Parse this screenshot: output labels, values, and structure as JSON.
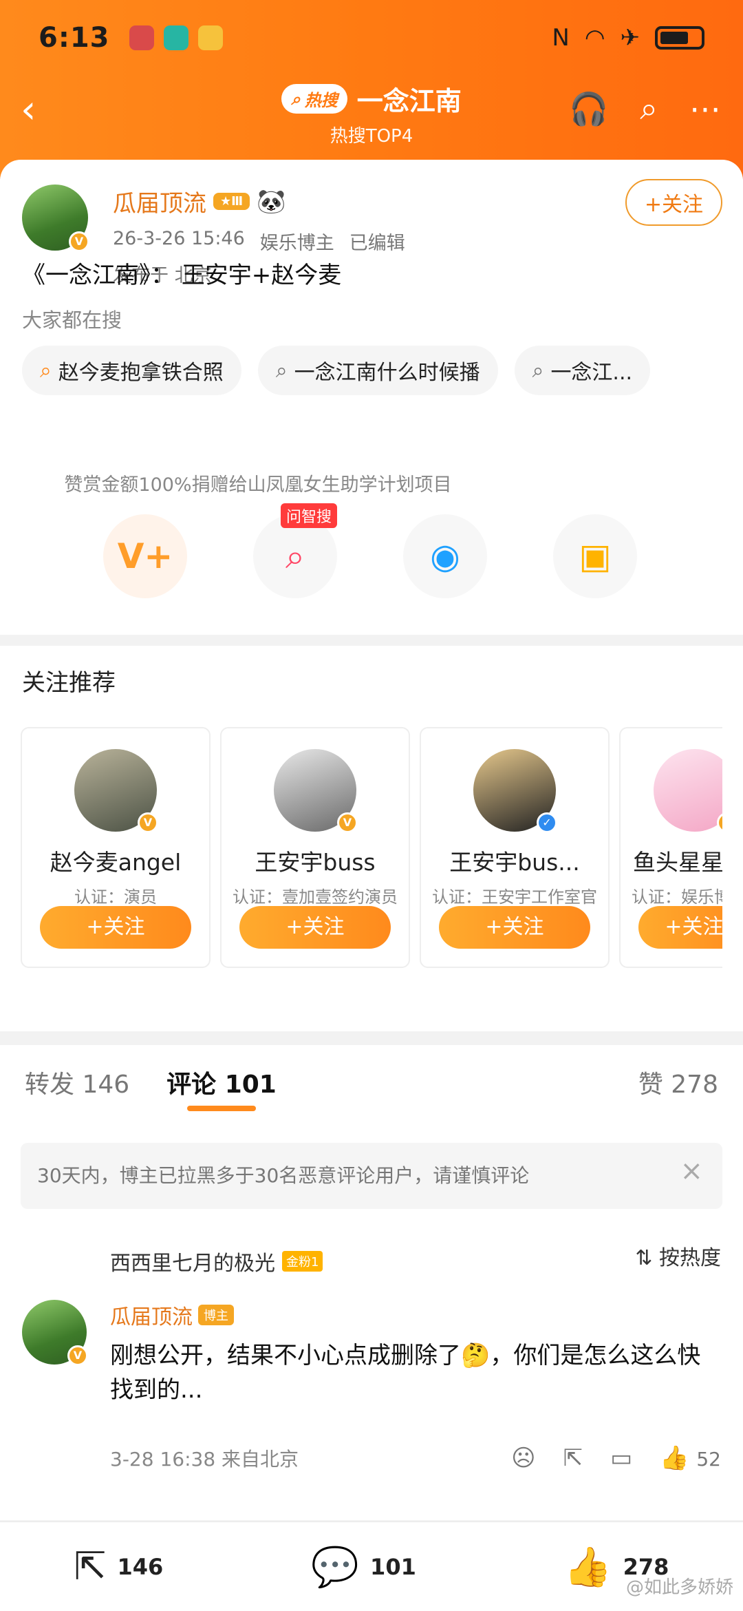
{
  "status": {
    "time": "6:13"
  },
  "nav": {
    "badge": "热搜",
    "title": "一念江南",
    "subtitle": "热搜TOP4"
  },
  "post": {
    "author": "瓜届顶流",
    "meta_date": "26-3-26 15:46",
    "meta_tag": "娱乐博主",
    "meta_edited": "已编辑",
    "location": "发布于 北京",
    "follow": "+关注",
    "text": "《一念江南》： 王安宇+赵今麦",
    "search_label": "大家都在搜",
    "chips": [
      "赵今麦抱拿铁合照",
      "一念江南什么时候播",
      "一念江..."
    ],
    "donate_text": "赞赏金额100%捐赠给山凤凰女生助学计划项目",
    "ai_tag": "问智搜"
  },
  "recommend": {
    "title": "关注推荐",
    "cards": [
      {
        "name": "赵今麦angel",
        "desc": "认证：演员",
        "follow": "+关注"
      },
      {
        "name": "王安宇buss",
        "desc": "认证：壹加壹签约演员",
        "follow": "+关注"
      },
      {
        "name": "王安宇bus...",
        "desc": "认证：王安宇工作室官方微博",
        "follow": "+关注"
      },
      {
        "name": "鱼头星星",
        "desc": "认证：娱乐博话主持人（一",
        "follow": "+关注"
      }
    ]
  },
  "comments": {
    "tabs": [
      {
        "label": "转发 146"
      },
      {
        "label": "评论 101"
      },
      {
        "label": "赞 278"
      }
    ],
    "notice": "30天内，博主已拉黑多于30名恶意评论用户，请谨慎评论",
    "sort": "按热度",
    "item": {
      "author": "瓜届顶流",
      "badge": "博主",
      "text": "刚想公开，结果不小心点成删除了🤔，你们是怎么这么快找到的...",
      "time": "3-28 16:38  来自北京",
      "likes": "52"
    },
    "reply_preview": {
      "author": "西西里七月的极光",
      "badge": "金粉1"
    }
  },
  "bottom": {
    "repost": "146",
    "comment": "101",
    "like": "278"
  },
  "watermark": "@如此多娇娇"
}
